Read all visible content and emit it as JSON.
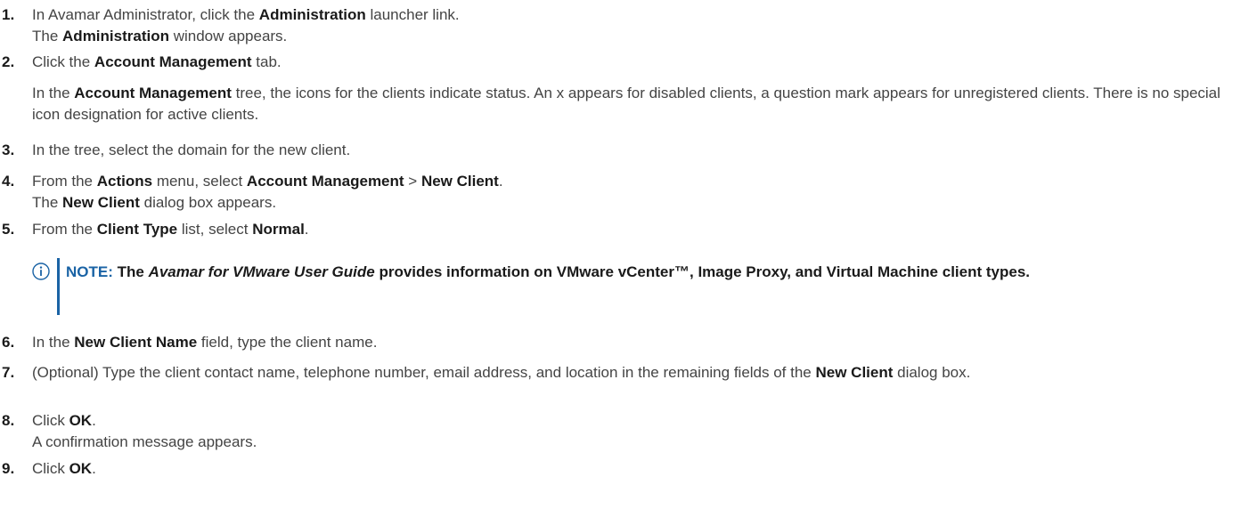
{
  "steps": [
    {
      "num": "1.",
      "segs": [
        {
          "t": "In Avamar Administrator, click the "
        },
        {
          "t": "Administration",
          "b": true
        },
        {
          "t": " launcher link."
        }
      ],
      "result": [
        {
          "t": "The "
        },
        {
          "t": "Administration",
          "b": true
        },
        {
          "t": " window appears."
        }
      ]
    },
    {
      "num": "2.",
      "segs": [
        {
          "t": "Click the "
        },
        {
          "t": "Account Management",
          "b": true
        },
        {
          "t": " tab."
        }
      ],
      "detail": [
        {
          "t": "In the "
        },
        {
          "t": "Account Management",
          "b": true
        },
        {
          "t": " tree, the icons for the clients indicate status. An x appears for disabled clients, a question mark appears for unregistered clients. There is no special icon designation for active clients."
        }
      ]
    },
    {
      "num": "3.",
      "segs": [
        {
          "t": "In the tree, select the domain for the new client."
        }
      ]
    },
    {
      "num": "4.",
      "segs": [
        {
          "t": "From the "
        },
        {
          "t": "Actions",
          "b": true
        },
        {
          "t": " menu, select "
        },
        {
          "t": "Account Management",
          "b": true
        },
        {
          "t": " > "
        },
        {
          "t": "New Client",
          "b": true
        },
        {
          "t": "."
        }
      ],
      "result": [
        {
          "t": "The "
        },
        {
          "t": "New Client",
          "b": true
        },
        {
          "t": " dialog box appears."
        }
      ]
    },
    {
      "num": "5.",
      "segs": [
        {
          "t": "From the "
        },
        {
          "t": "Client Type",
          "b": true
        },
        {
          "t": " list, select "
        },
        {
          "t": "Normal",
          "b": true
        },
        {
          "t": "."
        }
      ]
    },
    {
      "num": "6.",
      "segs": [
        {
          "t": "In the "
        },
        {
          "t": "New Client Name",
          "b": true
        },
        {
          "t": " field, type the client name."
        }
      ]
    },
    {
      "num": "7.",
      "segs": [
        {
          "t": "(Optional) Type the client contact name, telephone number, email address, and location in the remaining fields of the "
        },
        {
          "t": "New Client",
          "b": true
        },
        {
          "t": " dialog box."
        }
      ]
    },
    {
      "num": "8.",
      "segs": [
        {
          "t": "Click "
        },
        {
          "t": "OK",
          "b": true
        },
        {
          "t": "."
        }
      ],
      "result": [
        {
          "t": "A confirmation message appears."
        }
      ]
    },
    {
      "num": "9.",
      "segs": [
        {
          "t": "Click "
        },
        {
          "t": "OK",
          "b": true
        },
        {
          "t": "."
        }
      ]
    }
  ],
  "note": {
    "label": "NOTE:",
    "prefix": " The ",
    "title": "Avamar for VMware User Guide",
    "suffix": " provides information on VMware vCenter™, Image Proxy, and Virtual Machine client types."
  },
  "colors": {
    "accent": "#1a63a5",
    "text": "#444444",
    "bold": "#1a1a1a"
  },
  "note_icon": "info-circle-icon"
}
